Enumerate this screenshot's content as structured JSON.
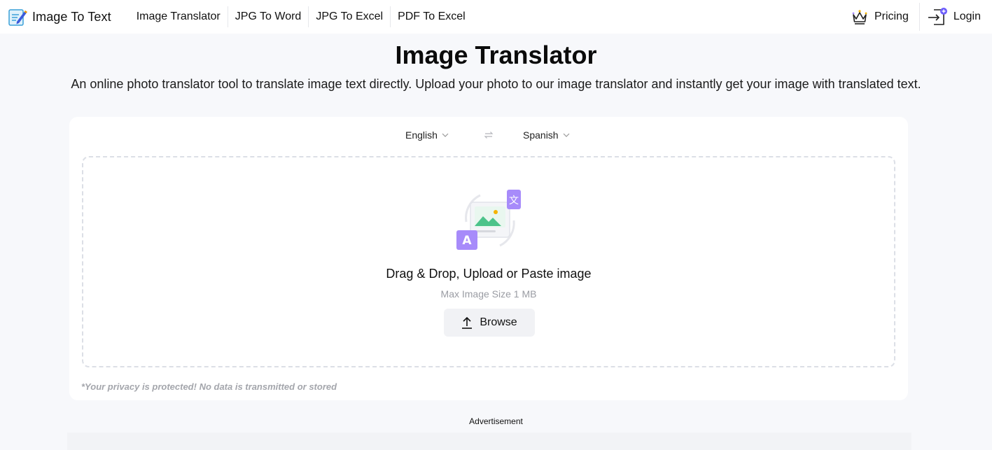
{
  "header": {
    "brand": "Image To Text",
    "nav": [
      {
        "label": "Image Translator"
      },
      {
        "label": "JPG To Word"
      },
      {
        "label": "JPG To Excel"
      },
      {
        "label": "PDF To Excel"
      }
    ],
    "pricing_label": "Pricing",
    "login_label": "Login"
  },
  "hero": {
    "title": "Image Translator",
    "subtitle": "An online photo translator tool to translate image text directly. Upload your photo to our image translator and instantly get your image with translated text."
  },
  "tool": {
    "source_language": "English",
    "target_language": "Spanish",
    "dropzone_title": "Drag & Drop, Upload or Paste image",
    "dropzone_hint": "Max Image Size 1 MB",
    "browse_label": "Browse",
    "privacy_note": "*Your privacy is protected! No data is transmitted or stored"
  },
  "ad": {
    "label": "Advertisement"
  },
  "colors": {
    "accent": "#a78bfa",
    "background": "#f7f8fb",
    "dashed_border": "#dcdfe6"
  }
}
